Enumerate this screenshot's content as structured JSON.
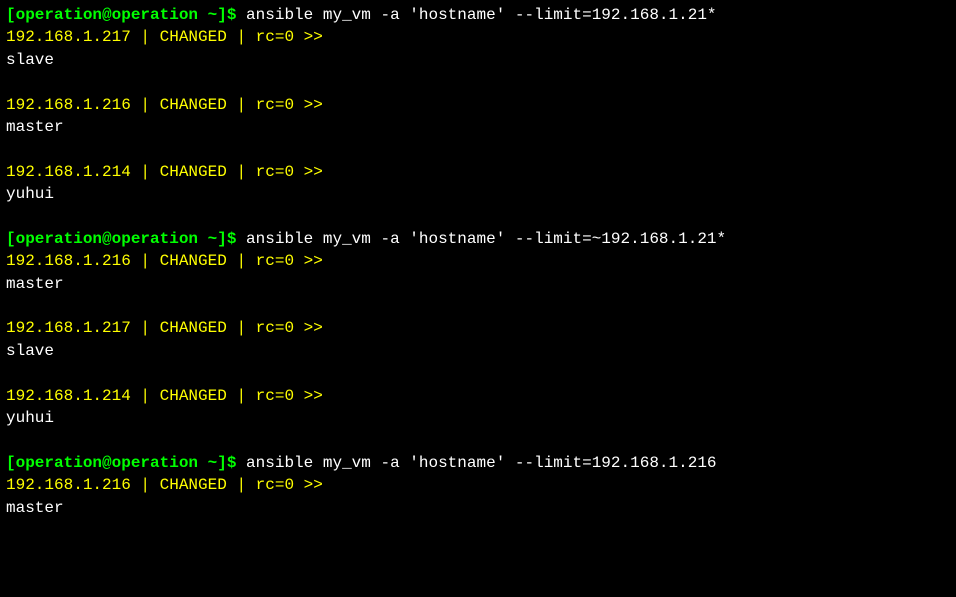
{
  "blocks": [
    {
      "prompt": "[operation@operation ~]$ ",
      "command": "ansible my_vm -a 'hostname' --limit=192.168.1.21*",
      "results": [
        {
          "status_line": "192.168.1.217 | CHANGED | rc=0 >>",
          "hostname": "slave"
        },
        {
          "status_line": "192.168.1.216 | CHANGED | rc=0 >>",
          "hostname": "master"
        },
        {
          "status_line": "192.168.1.214 | CHANGED | rc=0 >>",
          "hostname": "yuhui"
        }
      ]
    },
    {
      "prompt": "[operation@operation ~]$ ",
      "command": "ansible my_vm -a 'hostname' --limit=~192.168.1.21*",
      "results": [
        {
          "status_line": "192.168.1.216 | CHANGED | rc=0 >>",
          "hostname": "master"
        },
        {
          "status_line": "192.168.1.217 | CHANGED | rc=0 >>",
          "hostname": "slave"
        },
        {
          "status_line": "192.168.1.214 | CHANGED | rc=0 >>",
          "hostname": "yuhui"
        }
      ]
    },
    {
      "prompt": "[operation@operation ~]$ ",
      "command": "ansible my_vm -a 'hostname' --limit=192.168.1.216",
      "results": [
        {
          "status_line": "192.168.1.216 | CHANGED | rc=0 >>",
          "hostname": "master"
        }
      ]
    }
  ]
}
